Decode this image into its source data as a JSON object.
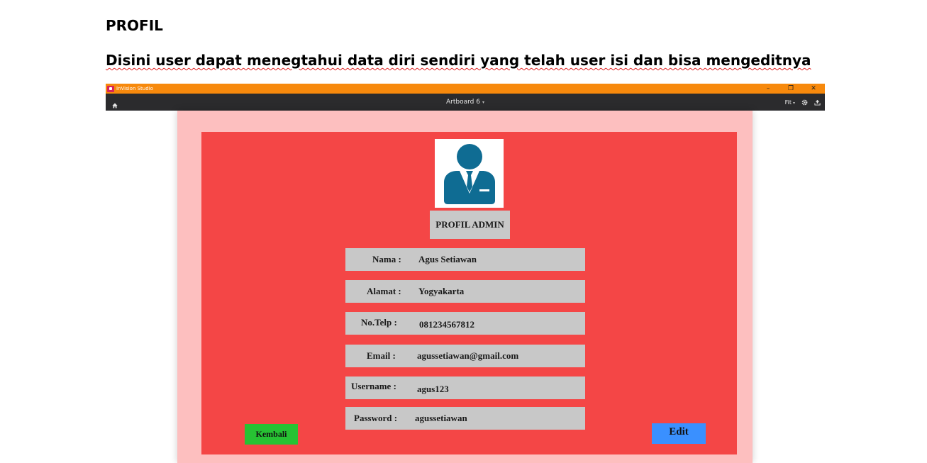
{
  "document": {
    "heading": "PROFIL",
    "description": "Disini user dapat menegtahui data diri sendiri yang telah user isi dan bisa mengeditnya"
  },
  "window": {
    "app_title": "InVision Studio",
    "controls": {
      "minimize": "–",
      "restore": "❐",
      "close": "✕"
    }
  },
  "toolbar": {
    "artboard_label": "Artboard 6",
    "zoom_label": "Fit",
    "icons": [
      "home-icon",
      "chevron-down-icon",
      "gear-icon",
      "upload-icon"
    ]
  },
  "profile": {
    "title": "PROFIL ADMIN",
    "avatar_icon": "user-businessman-icon",
    "fields": [
      {
        "label": "Nama  :",
        "value": "Agus Setiawan"
      },
      {
        "label": "Alamat  :",
        "value": "Yogyakarta"
      },
      {
        "label": "No.Telp  :",
        "value": "081234567812"
      },
      {
        "label": "Email  :",
        "value": "agussetiawan@gmail.com"
      },
      {
        "label": "Username  :",
        "value": "agus123"
      },
      {
        "label": "Password  :",
        "value": "agussetiawan"
      }
    ],
    "back_button": "Kembali",
    "edit_button": "Edit"
  },
  "colors": {
    "titlebar": "#f7890c",
    "toolbar": "#2b2b2d",
    "artboard_bg": "#fdbfbf",
    "panel": "#f44646",
    "field_bg": "#c8c8c8",
    "avatar": "#0f6c93",
    "back_button": "#27c233",
    "edit_button": "#3a90ff"
  }
}
